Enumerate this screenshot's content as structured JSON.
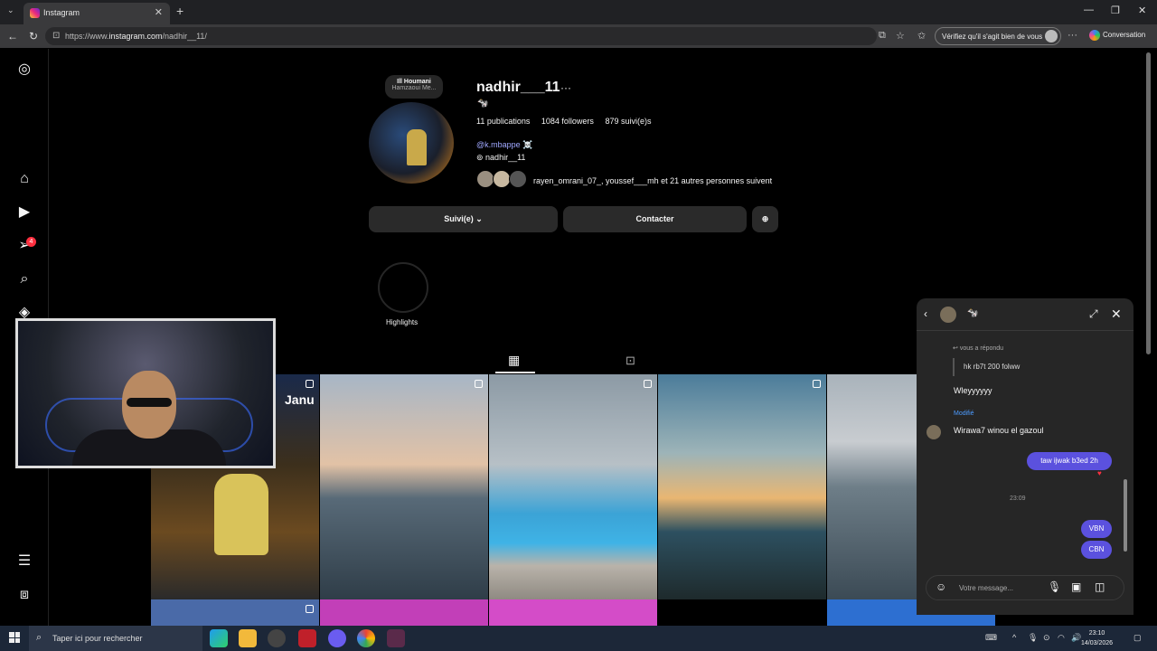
{
  "browser": {
    "tab_title": "Instagram",
    "url_prefix": "https://www.",
    "url_host": "instagram.com",
    "url_path": "/nadhir__11/",
    "verify_label": "Vérifiez qu'il s'agit bien de vous",
    "conversation_label": "Conversation"
  },
  "profile": {
    "note_title": "Ill Houmani",
    "note_subtitle": "Hamzaoui Me...",
    "username": "nadhir___11",
    "bio_emoji": "🐄",
    "publications": "11 publications",
    "followers": "1084 followers",
    "following": "879 suivi(e)s",
    "mention": "@k.mbappe",
    "mention_emoji": "☠️",
    "threads_handle": "nadhir__11",
    "followed_by": "rayen_omrani_07_, youssef___mh et 21 autres personnes suivent",
    "follow_button": "Suivi(e) ⌄",
    "contact_button": "Contacter",
    "highlights_label": "Highlights",
    "post_overlay_text": "Janu"
  },
  "nav": {
    "notifications_badge": "4"
  },
  "dm": {
    "header_emoji": "🐄",
    "replied_label": "vous a répondu",
    "quoted_message": "hk rb7t 200 folww",
    "msg1": "Wleyyyyyy",
    "edited_label": "Modifié",
    "msg2": "Wirawa7 winou el gazoul",
    "out1": "taw ijwak b3ed 2h",
    "time": "23:09",
    "out2": "VBN",
    "out3": "CBN",
    "composer_placeholder": "Votre message..."
  },
  "taskbar": {
    "search_placeholder": "Taper ici pour rechercher",
    "time": "23:10",
    "date": "14/03/2026"
  }
}
